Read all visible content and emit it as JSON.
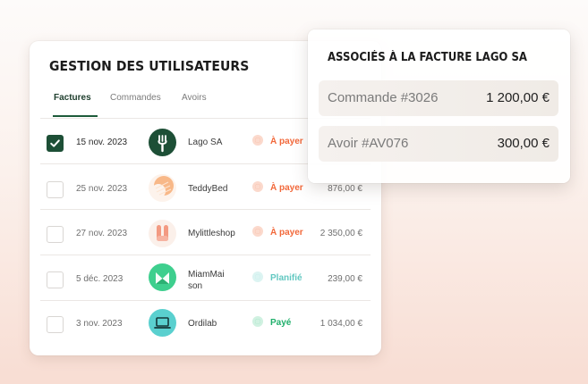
{
  "panel": {
    "title": "GESTION DES UTILISATEURS",
    "tabs": [
      {
        "label": "Factures",
        "active": true
      },
      {
        "label": "Commandes",
        "active": false
      },
      {
        "label": "Avoirs",
        "active": false
      }
    ]
  },
  "invoices": [
    {
      "checked": true,
      "date": "15 nov. 2023",
      "company": "Lago SA",
      "status": "À payer",
      "amount": "",
      "logo_icon": "fork-icon",
      "logo_color": "#1d4f36"
    },
    {
      "checked": false,
      "date": "25 nov. 2023",
      "company": "TeddyBed",
      "status": "À payer",
      "amount": "876,00 €",
      "logo_icon": "teddybed-logo-icon",
      "logo_color": "#f7b98c"
    },
    {
      "checked": false,
      "date": "27 nov. 2023",
      "company": "Mylittleshop",
      "status": "À payer",
      "amount": "2 350,00 €",
      "logo_icon": "mylittleshop-logo-icon",
      "logo_color": "#f39a82"
    },
    {
      "checked": false,
      "date": "5 déc. 2023",
      "company": "MiamMai son",
      "company_line1": "MiamMai",
      "company_line2": "son",
      "status": "Planifié",
      "amount": "239,00 €",
      "logo_icon": "miammaison-logo-icon",
      "logo_color": "#3ecf8e"
    },
    {
      "checked": false,
      "date": "3 nov. 2023",
      "company": "Ordilab",
      "status": "Payé",
      "amount": "1 034,00 €",
      "logo_icon": "laptop-icon",
      "logo_color": "#5ad0cf"
    }
  ],
  "status_colors": {
    "À payer": {
      "dot": "#f2683a",
      "halo": "#fbd9cc",
      "text": "#f2683a"
    },
    "Planifié": {
      "dot": "#7fd9d4",
      "halo": "#dcf4f2",
      "text": "#62c8c1"
    },
    "Payé": {
      "dot": "#27c07a",
      "halo": "#d0f1e1",
      "text": "#1faf6b"
    }
  },
  "popup": {
    "title": "ASSOCIÉS À LA FACTURE LAGO SA",
    "items": [
      {
        "label": "Commande #3026",
        "amount": "1 200,00  €"
      },
      {
        "label": "Avoir #AV076",
        "amount": "300,00 €"
      }
    ]
  },
  "colors": {
    "brand_green": "#1d4f36",
    "background_peach": "#f8ddd3"
  }
}
